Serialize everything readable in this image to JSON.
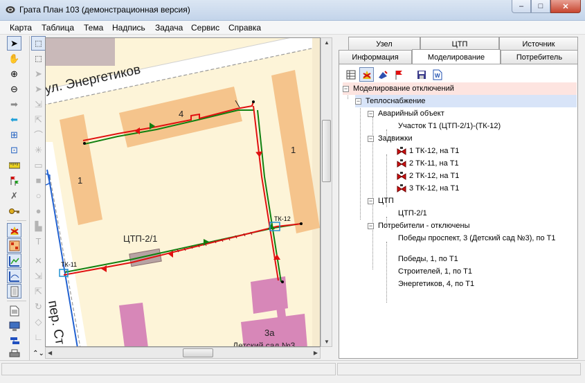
{
  "window": {
    "title": "Грата План 103 (демонстрационная версия)",
    "minimize": "–",
    "maximize": "□",
    "close": "✕"
  },
  "menu": [
    "Карта",
    "Таблица",
    "Тема",
    "Надпись",
    "Задача",
    "Сервис",
    "Справка"
  ],
  "map": {
    "street_top": "ул. Энергетиков",
    "street_bottom": "пер. Ст",
    "building_labels": [
      "4",
      "1",
      "1",
      "3а"
    ],
    "node_labels": [
      "ТК-11",
      "ТК-12"
    ],
    "ctp_label": "ЦТП-2/1",
    "kindergarten": "Детский сад №3"
  },
  "panel": {
    "tabs_row1": [
      "Узел",
      "ЦТП",
      "Источник"
    ],
    "tabs_row2": [
      "Информация",
      "Моделирование",
      "Потребитель"
    ],
    "active_tab": "Моделирование",
    "tree": {
      "root": "Моделирование отключений",
      "system": "Теплоснабжение",
      "emergency_title": "Аварийный объект",
      "emergency_item": "Участок Т1 (ЦТП-2/1)-(ТК-12)",
      "valves_title": "Задвижки",
      "valves": [
        "1 ТК-12, на Т1",
        "2 ТК-11, на Т1",
        "2 ТК-12, на Т1",
        "3 ТК-12, на Т1"
      ],
      "ctp_title": "ЦТП",
      "ctp_item": "ЦТП-2/1",
      "consumers_title": "Потребители - отключены",
      "consumers": [
        "Победы проспект, 3 (Детский сад №3), по Т1",
        "Победы, 1, по Т1",
        "Строителей, 1, по Т1",
        "Энергетиков, 4, по Т1"
      ]
    }
  },
  "colors": {
    "map_bg": "#fdf4d8",
    "building": "#f5c48c",
    "pink_building": "#d787b8",
    "pipe_supply": "#e01010",
    "pipe_return": "#108010",
    "road": "#ffffff"
  }
}
